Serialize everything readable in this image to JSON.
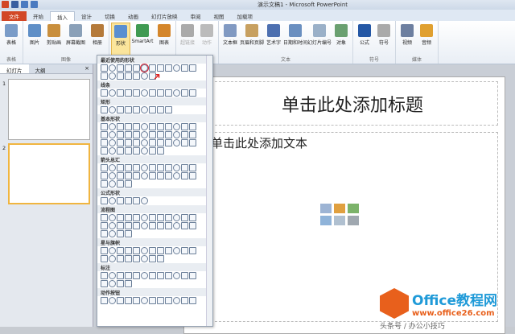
{
  "window": {
    "title": "演示文稿1 - Microsoft PowerPoint"
  },
  "tabs": [
    "文件",
    "开始",
    "插入",
    "设计",
    "切换",
    "动画",
    "幻灯片放映",
    "审阅",
    "视图",
    "加载项"
  ],
  "ribbon": {
    "groups": [
      {
        "label": "表格",
        "buttons": [
          "表格"
        ]
      },
      {
        "label": "图像",
        "buttons": [
          "图片",
          "剪贴画",
          "屏幕截图",
          "相册"
        ]
      },
      {
        "label": "",
        "buttons": [
          "形状",
          "SmartArt",
          "图表"
        ]
      },
      {
        "label": "",
        "buttons": [
          "超链接",
          "动作"
        ]
      },
      {
        "label": "文本",
        "buttons": [
          "文本框",
          "页眉和页脚",
          "艺术字",
          "日期和时间",
          "幻灯片编号",
          "对象"
        ]
      },
      {
        "label": "符号",
        "buttons": [
          "公式",
          "符号"
        ]
      },
      {
        "label": "媒体",
        "buttons": [
          "视频",
          "音频"
        ]
      }
    ]
  },
  "pane": {
    "tabs": [
      "幻灯片",
      "大纲"
    ],
    "close": "×",
    "slides": [
      "1",
      "2"
    ]
  },
  "slide": {
    "title_placeholder": "单击此处添加标题",
    "content_placeholder": "单击此处添加文本"
  },
  "shapes_menu": {
    "sections": [
      {
        "label": "最近使用的形状",
        "count": 19
      },
      {
        "label": "线条",
        "count": 12
      },
      {
        "label": "矩形",
        "count": 9
      },
      {
        "label": "基本形状",
        "count": 44
      },
      {
        "label": "箭头总汇",
        "count": 28
      },
      {
        "label": "公式形状",
        "count": 6
      },
      {
        "label": "流程图",
        "count": 28
      },
      {
        "label": "星与旗帜",
        "count": 20
      },
      {
        "label": "标注",
        "count": 16
      },
      {
        "label": "动作按钮",
        "count": 12
      }
    ]
  },
  "watermark": {
    "brand": "Office教程网",
    "url": "www.office26.com",
    "sub": "头条号 / 办公小技巧"
  },
  "colors": {
    "file_tab": "#d24726",
    "accent": "#e8601c"
  }
}
